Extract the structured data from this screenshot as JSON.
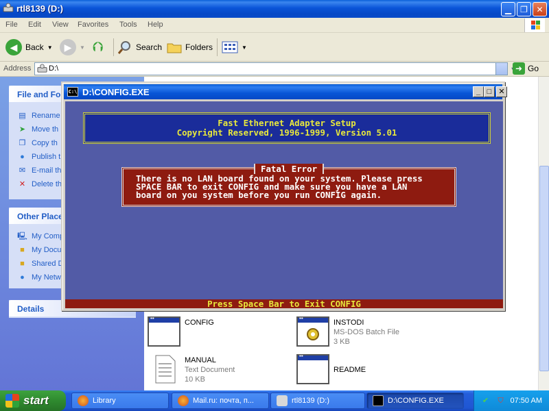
{
  "explorer": {
    "title": "rtl8139 (D:)",
    "menu": [
      "File",
      "Edit",
      "View",
      "Favorites",
      "Tools",
      "Help"
    ],
    "toolbar": {
      "back": "Back",
      "search": "Search",
      "folders": "Folders"
    },
    "address": {
      "label": "Address",
      "value": "D:\\",
      "go": "Go"
    },
    "taskpane": {
      "file_tasks": {
        "title": "File and Fol",
        "items": [
          "Rename",
          "Move th",
          "Copy th",
          "Publish t",
          "E-mail th",
          "Delete th"
        ]
      },
      "other_places": {
        "title": "Other Place",
        "items": [
          "My Comp",
          "My Docu",
          "Shared D",
          "My Netw"
        ]
      },
      "details": {
        "title": "Details"
      }
    },
    "files": [
      {
        "name": "CONFIG",
        "type": "",
        "size": ""
      },
      {
        "name": "INSTODI",
        "type": "MS-DOS Batch File",
        "size": "3 KB"
      },
      {
        "name": "MANUAL",
        "type": "Text Document",
        "size": "10 KB"
      },
      {
        "name": "README",
        "type": "",
        "size": ""
      }
    ]
  },
  "console": {
    "title": "D:\\CONFIG.EXE",
    "icon_text": "C:\\",
    "banner": [
      "Fast Ethernet Adapter Setup",
      "Copyright Reserved, 1996-1999, Version 5.01"
    ],
    "error": {
      "title": "Fatal Error",
      "lines": [
        "There is no LAN board found on your system. Please press",
        "SPACE BAR to exit CONFIG and make sure you have a LAN",
        "board on you system before you run CONFIG again."
      ]
    },
    "status": "Press Space Bar to Exit CONFIG"
  },
  "taskbar": {
    "start": "start",
    "tasks": [
      "Library",
      "Mail.ru: почта, п...",
      "rtl8139 (D:)",
      "D:\\CONFIG.EXE"
    ],
    "clock": "07:50 AM"
  },
  "colors": {
    "console_bg": "#525ba6",
    "banner_bg": "#1a2c9a",
    "banner_text": "#e8e83c",
    "error_bg": "#8e1b10",
    "xp_blue": "#0a54d8"
  }
}
